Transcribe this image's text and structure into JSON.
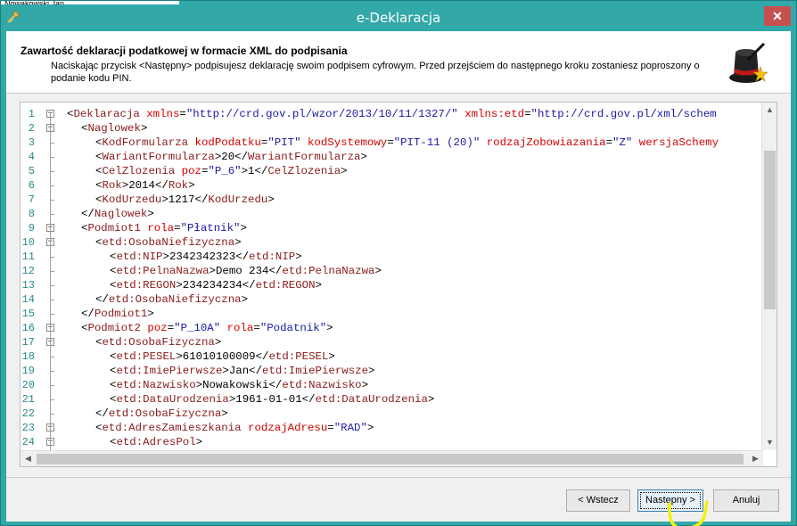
{
  "background_window": {
    "text": "Nowakowski Jan"
  },
  "window": {
    "title": "e-Deklaracja"
  },
  "header": {
    "title": "Zawartość deklaracji podatkowej w formacie XML do podpisania",
    "description": "Naciskając przycisk <Następny> podpisujesz deklarację swoim podpisem cyfrowym. Przed przejściem do następnego kroku zostaniesz poproszony o podanie kodu PIN."
  },
  "editor": {
    "lines": [
      {
        "n": "1",
        "indent": 0,
        "parts": [
          [
            "t-b",
            "<"
          ],
          [
            "t-tag",
            "Deklaracja"
          ],
          [
            "t-b",
            " "
          ],
          [
            "t-attr",
            "xmlns"
          ],
          [
            "t-b",
            "="
          ],
          [
            "t-val",
            "\"http://crd.gov.pl/wzor/2013/10/11/1327/\""
          ],
          [
            "t-b",
            " "
          ],
          [
            "t-attr",
            "xmlns:etd"
          ],
          [
            "t-b",
            "="
          ],
          [
            "t-val",
            "\"http://crd.gov.pl/xml/schem"
          ]
        ]
      },
      {
        "n": "2",
        "indent": 1,
        "parts": [
          [
            "t-b",
            "<"
          ],
          [
            "t-tag",
            "Naglowek"
          ],
          [
            "t-b",
            ">"
          ]
        ]
      },
      {
        "n": "3",
        "indent": 2,
        "parts": [
          [
            "t-b",
            "<"
          ],
          [
            "t-tag",
            "KodFormularza"
          ],
          [
            "t-b",
            " "
          ],
          [
            "t-attr",
            "kodPodatku"
          ],
          [
            "t-b",
            "="
          ],
          [
            "t-val",
            "\"PIT\""
          ],
          [
            "t-b",
            " "
          ],
          [
            "t-attr",
            "kodSystemowy"
          ],
          [
            "t-b",
            "="
          ],
          [
            "t-val",
            "\"PIT-11 (20)\""
          ],
          [
            "t-b",
            " "
          ],
          [
            "t-attr",
            "rodzajZobowiazania"
          ],
          [
            "t-b",
            "="
          ],
          [
            "t-val",
            "\"Z\""
          ],
          [
            "t-b",
            " "
          ],
          [
            "t-attr",
            "wersjaSchemy"
          ]
        ]
      },
      {
        "n": "4",
        "indent": 2,
        "parts": [
          [
            "t-b",
            "<"
          ],
          [
            "t-tag",
            "WariantFormularza"
          ],
          [
            "t-b",
            ">"
          ],
          [
            "t-txt",
            "20"
          ],
          [
            "t-b",
            "</"
          ],
          [
            "t-tag",
            "WariantFormularza"
          ],
          [
            "t-b",
            ">"
          ]
        ]
      },
      {
        "n": "5",
        "indent": 2,
        "parts": [
          [
            "t-b",
            "<"
          ],
          [
            "t-tag",
            "CelZlozenia"
          ],
          [
            "t-b",
            " "
          ],
          [
            "t-attr",
            "poz"
          ],
          [
            "t-b",
            "="
          ],
          [
            "t-val",
            "\"P_6\""
          ],
          [
            "t-b",
            ">"
          ],
          [
            "t-txt",
            "1"
          ],
          [
            "t-b",
            "</"
          ],
          [
            "t-tag",
            "CelZlozenia"
          ],
          [
            "t-b",
            ">"
          ]
        ]
      },
      {
        "n": "6",
        "indent": 2,
        "parts": [
          [
            "t-b",
            "<"
          ],
          [
            "t-tag",
            "Rok"
          ],
          [
            "t-b",
            ">"
          ],
          [
            "t-txt",
            "2014"
          ],
          [
            "t-b",
            "</"
          ],
          [
            "t-tag",
            "Rok"
          ],
          [
            "t-b",
            ">"
          ]
        ]
      },
      {
        "n": "7",
        "indent": 2,
        "parts": [
          [
            "t-b",
            "<"
          ],
          [
            "t-tag",
            "KodUrzedu"
          ],
          [
            "t-b",
            ">"
          ],
          [
            "t-txt",
            "1217"
          ],
          [
            "t-b",
            "</"
          ],
          [
            "t-tag",
            "KodUrzedu"
          ],
          [
            "t-b",
            ">"
          ]
        ]
      },
      {
        "n": "8",
        "indent": 1,
        "parts": [
          [
            "t-b",
            "</"
          ],
          [
            "t-tag",
            "Naglowek"
          ],
          [
            "t-b",
            ">"
          ]
        ]
      },
      {
        "n": "9",
        "indent": 1,
        "parts": [
          [
            "t-b",
            "<"
          ],
          [
            "t-tag",
            "Podmiot1"
          ],
          [
            "t-b",
            " "
          ],
          [
            "t-attr",
            "rola"
          ],
          [
            "t-b",
            "="
          ],
          [
            "t-val",
            "\"Płatnik\""
          ],
          [
            "t-b",
            ">"
          ]
        ]
      },
      {
        "n": "10",
        "indent": 2,
        "parts": [
          [
            "t-b",
            "<"
          ],
          [
            "t-tag",
            "etd:OsobaNiefizyczna"
          ],
          [
            "t-b",
            ">"
          ]
        ]
      },
      {
        "n": "11",
        "indent": 3,
        "parts": [
          [
            "t-b",
            "<"
          ],
          [
            "t-tag",
            "etd:NIP"
          ],
          [
            "t-b",
            ">"
          ],
          [
            "t-txt",
            "2342342323"
          ],
          [
            "t-b",
            "</"
          ],
          [
            "t-tag",
            "etd:NIP"
          ],
          [
            "t-b",
            ">"
          ]
        ]
      },
      {
        "n": "12",
        "indent": 3,
        "parts": [
          [
            "t-b",
            "<"
          ],
          [
            "t-tag",
            "etd:PelnaNazwa"
          ],
          [
            "t-b",
            ">"
          ],
          [
            "t-txt",
            "Demo 234"
          ],
          [
            "t-b",
            "</"
          ],
          [
            "t-tag",
            "etd:PelnaNazwa"
          ],
          [
            "t-b",
            ">"
          ]
        ]
      },
      {
        "n": "13",
        "indent": 3,
        "parts": [
          [
            "t-b",
            "<"
          ],
          [
            "t-tag",
            "etd:REGON"
          ],
          [
            "t-b",
            ">"
          ],
          [
            "t-txt",
            "234234234"
          ],
          [
            "t-b",
            "</"
          ],
          [
            "t-tag",
            "etd:REGON"
          ],
          [
            "t-b",
            ">"
          ]
        ]
      },
      {
        "n": "14",
        "indent": 2,
        "parts": [
          [
            "t-b",
            "</"
          ],
          [
            "t-tag",
            "etd:OsobaNiefizyczna"
          ],
          [
            "t-b",
            ">"
          ]
        ]
      },
      {
        "n": "15",
        "indent": 1,
        "parts": [
          [
            "t-b",
            "</"
          ],
          [
            "t-tag",
            "Podmiot1"
          ],
          [
            "t-b",
            ">"
          ]
        ]
      },
      {
        "n": "16",
        "indent": 1,
        "parts": [
          [
            "t-b",
            "<"
          ],
          [
            "t-tag",
            "Podmiot2"
          ],
          [
            "t-b",
            " "
          ],
          [
            "t-attr",
            "poz"
          ],
          [
            "t-b",
            "="
          ],
          [
            "t-val",
            "\"P_10A\""
          ],
          [
            "t-b",
            " "
          ],
          [
            "t-attr",
            "rola"
          ],
          [
            "t-b",
            "="
          ],
          [
            "t-val",
            "\"Podatnik\""
          ],
          [
            "t-b",
            ">"
          ]
        ]
      },
      {
        "n": "17",
        "indent": 2,
        "parts": [
          [
            "t-b",
            "<"
          ],
          [
            "t-tag",
            "etd:OsobaFizyczna"
          ],
          [
            "t-b",
            ">"
          ]
        ]
      },
      {
        "n": "18",
        "indent": 3,
        "parts": [
          [
            "t-b",
            "<"
          ],
          [
            "t-tag",
            "etd:PESEL"
          ],
          [
            "t-b",
            ">"
          ],
          [
            "t-txt",
            "61010100009"
          ],
          [
            "t-b",
            "</"
          ],
          [
            "t-tag",
            "etd:PESEL"
          ],
          [
            "t-b",
            ">"
          ]
        ]
      },
      {
        "n": "19",
        "indent": 3,
        "parts": [
          [
            "t-b",
            "<"
          ],
          [
            "t-tag",
            "etd:ImiePierwsze"
          ],
          [
            "t-b",
            ">"
          ],
          [
            "t-txt",
            "Jan"
          ],
          [
            "t-b",
            "</"
          ],
          [
            "t-tag",
            "etd:ImiePierwsze"
          ],
          [
            "t-b",
            ">"
          ]
        ]
      },
      {
        "n": "20",
        "indent": 3,
        "parts": [
          [
            "t-b",
            "<"
          ],
          [
            "t-tag",
            "etd:Nazwisko"
          ],
          [
            "t-b",
            ">"
          ],
          [
            "t-txt",
            "Nowakowski"
          ],
          [
            "t-b",
            "</"
          ],
          [
            "t-tag",
            "etd:Nazwisko"
          ],
          [
            "t-b",
            ">"
          ]
        ]
      },
      {
        "n": "21",
        "indent": 3,
        "parts": [
          [
            "t-b",
            "<"
          ],
          [
            "t-tag",
            "etd:DataUrodzenia"
          ],
          [
            "t-b",
            ">"
          ],
          [
            "t-txt",
            "1961-01-01"
          ],
          [
            "t-b",
            "</"
          ],
          [
            "t-tag",
            "etd:DataUrodzenia"
          ],
          [
            "t-b",
            ">"
          ]
        ]
      },
      {
        "n": "22",
        "indent": 2,
        "parts": [
          [
            "t-b",
            "</"
          ],
          [
            "t-tag",
            "etd:OsobaFizyczna"
          ],
          [
            "t-b",
            ">"
          ]
        ]
      },
      {
        "n": "23",
        "indent": 2,
        "parts": [
          [
            "t-b",
            "<"
          ],
          [
            "t-tag",
            "etd:AdresZamieszkania"
          ],
          [
            "t-b",
            " "
          ],
          [
            "t-attr",
            "rodzajAdresu"
          ],
          [
            "t-b",
            "="
          ],
          [
            "t-val",
            "\"RAD\""
          ],
          [
            "t-b",
            ">"
          ]
        ]
      },
      {
        "n": "24",
        "indent": 3,
        "parts": [
          [
            "t-b",
            "<"
          ],
          [
            "t-tag",
            "etd:AdresPol"
          ],
          [
            "t-b",
            ">"
          ]
        ]
      }
    ],
    "fold_markers": {
      "1": "−",
      "2": "−",
      "9": "−",
      "10": "−",
      "16": "−",
      "17": "−",
      "23": "−",
      "24": "−"
    }
  },
  "buttons": {
    "back": "< Wstecz",
    "next": "Następny >",
    "cancel": "Anuluj"
  },
  "colors": {
    "titlebar": "#32a8a8",
    "tag": "#8b1a1a",
    "attr": "#d40000",
    "value": "#1a1aa6",
    "close": "#c7504f"
  }
}
